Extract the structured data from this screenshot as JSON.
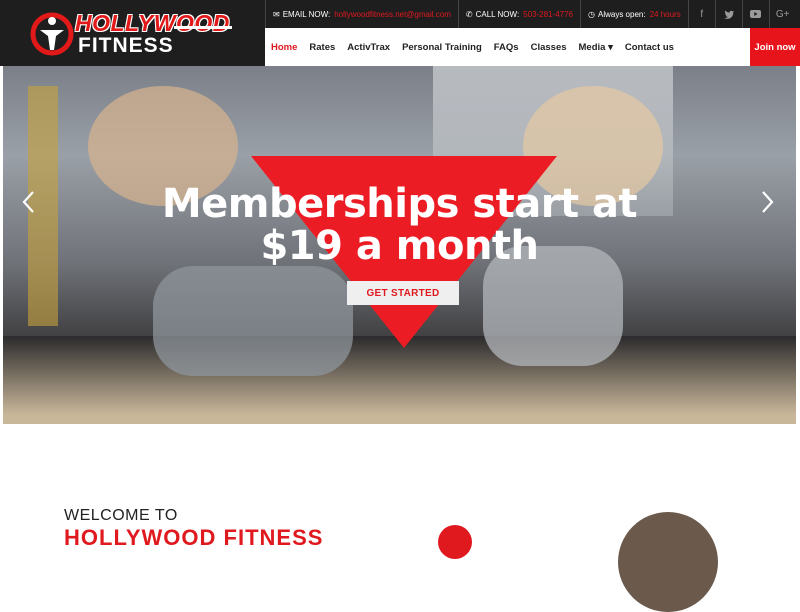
{
  "brand": {
    "line1": "HOLLYWOOD",
    "line2": "FITNESS"
  },
  "topbar": {
    "email_label": "EMAIL NOW:",
    "email_value": "hollywoodfitness.net@gmail.com",
    "call_label": "CALL NOW:",
    "call_value": "503-281-4776",
    "open_label": "Always open:",
    "open_value": "24 hours",
    "social_icons": [
      "facebook-icon",
      "twitter-icon",
      "youtube-icon",
      "google-plus-icon"
    ]
  },
  "nav": {
    "items": [
      {
        "label": "Home",
        "active": true
      },
      {
        "label": "Rates"
      },
      {
        "label": "ActivTrax"
      },
      {
        "label": "Personal Training"
      },
      {
        "label": "FAQs"
      },
      {
        "label": "Classes"
      },
      {
        "label": "Media ▾"
      },
      {
        "label": "Contact us"
      }
    ],
    "join_label": "Join now"
  },
  "hero": {
    "headline_line1": "Memberships start at",
    "headline_line2": "$19 a month",
    "cta_label": "GET STARTED",
    "prev_icon": "chevron-left-icon",
    "next_icon": "chevron-right-icon"
  },
  "welcome": {
    "line1": "WELCOME TO",
    "line2": "HOLLYWOOD FITNESS"
  },
  "colors": {
    "accent": "#e8141c",
    "header_bg": "#1e1e1e"
  }
}
